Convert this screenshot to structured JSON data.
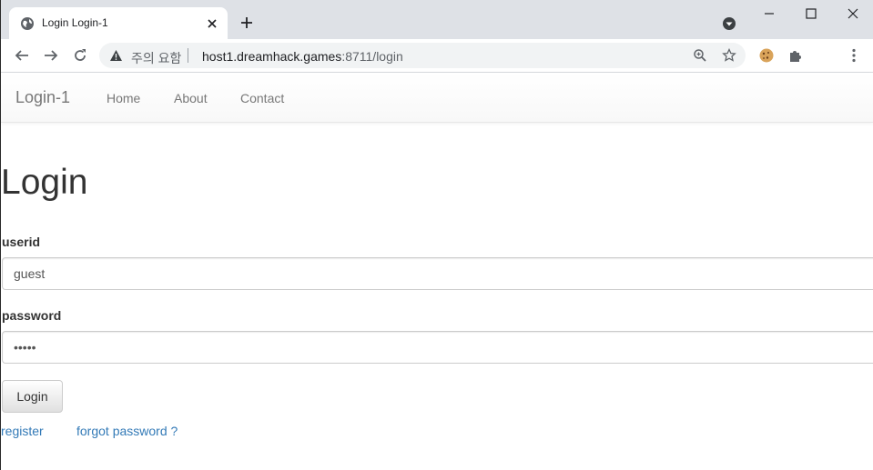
{
  "browser": {
    "tab": {
      "title": "Login Login-1"
    },
    "address_bar": {
      "security_label": "주의 요함",
      "url_host": "host1.dreamhack.games",
      "url_rest": ":8711/login"
    }
  },
  "navbar": {
    "brand": "Login-1",
    "links": [
      "Home",
      "About",
      "Contact"
    ]
  },
  "page": {
    "title": "Login",
    "userid_label": "userid",
    "userid_value": "guest",
    "password_label": "password",
    "password_value": "guest",
    "login_button": "Login",
    "register_link": "register",
    "forgot_link": "forgot password ?"
  }
}
